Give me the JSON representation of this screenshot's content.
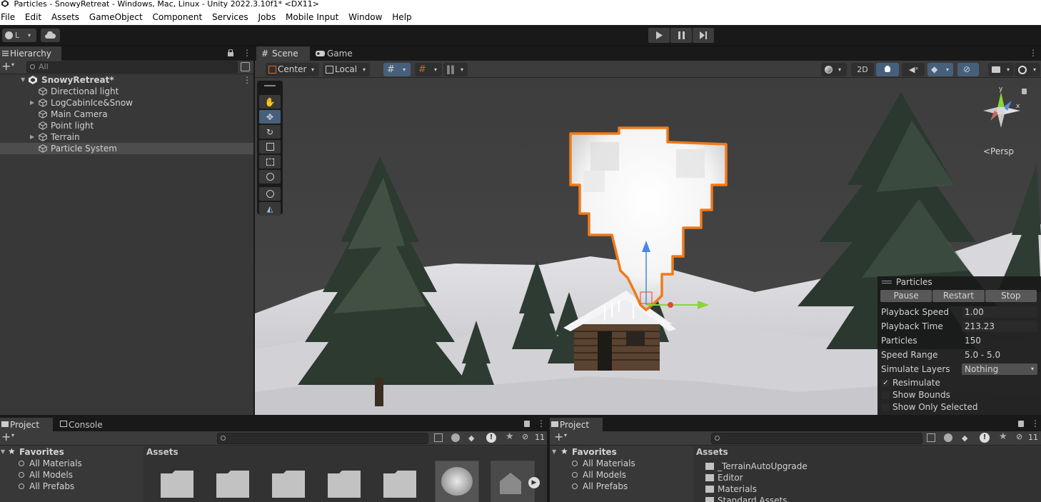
{
  "window": {
    "title": "Particles - SnowyRetreat - Windows, Mac, Linux - Unity 2022.3.10f1* <DX11>"
  },
  "menu": [
    "File",
    "Edit",
    "Assets",
    "GameObject",
    "Component",
    "Services",
    "Jobs",
    "Mobile Input",
    "Window",
    "Help"
  ],
  "toolbar": {
    "account_initial": "L"
  },
  "hierarchy": {
    "tab": "Hierarchy",
    "search_placeholder": "All",
    "scene_name": "SnowyRetreat*",
    "items": [
      {
        "label": "Directional light",
        "expandable": false
      },
      {
        "label": "LogCabinIce&Snow",
        "expandable": true
      },
      {
        "label": "Main Camera",
        "expandable": false
      },
      {
        "label": "Point light",
        "expandable": false
      },
      {
        "label": "Terrain",
        "expandable": true
      },
      {
        "label": "Particle System",
        "expandable": false,
        "selected": true
      }
    ]
  },
  "scene": {
    "tabs": [
      "Scene",
      "Game"
    ],
    "pivot": "Center",
    "space": "Local",
    "mode_2d": "2D",
    "persp_label": "<Persp",
    "gizmo_axes": {
      "y": "y",
      "x": "x"
    }
  },
  "particles_overlay": {
    "title": "Particles",
    "buttons": [
      "Pause",
      "Restart",
      "Stop"
    ],
    "playback_speed_label": "Playback Speed",
    "playback_speed": "1.00",
    "playback_time_label": "Playback Time",
    "playback_time": "213.23",
    "particles_label": "Particles",
    "particles": "150",
    "speed_range_label": "Speed Range",
    "speed_range": "5.0 - 5.0",
    "simulate_layers_label": "Simulate Layers",
    "simulate_layers": "Nothing",
    "checks": [
      {
        "label": "Resimulate",
        "checked": true
      },
      {
        "label": "Show Bounds",
        "checked": false
      },
      {
        "label": "Show Only Selected",
        "checked": false
      }
    ]
  },
  "project_left": {
    "tabs": [
      "Project",
      "Console"
    ],
    "favorites_label": "Favorites",
    "favorites": [
      "All Materials",
      "All Models",
      "All Prefabs"
    ],
    "assets_label": "Assets",
    "hidden_count": "11"
  },
  "project_right": {
    "tab": "Project",
    "favorites_label": "Favorites",
    "favorites": [
      "All Materials",
      "All Models",
      "All Prefabs"
    ],
    "assets_label": "Assets",
    "hidden_count": "11",
    "asset_folders": [
      "_TerrainAutoUpgrade",
      "Editor",
      "Materials",
      "Standard Assets"
    ]
  },
  "colors": {
    "selection_outline": "#f07a1a",
    "editor_bg": "#383838",
    "toolbar_bg": "#191919",
    "active_tool": "#46607c"
  }
}
